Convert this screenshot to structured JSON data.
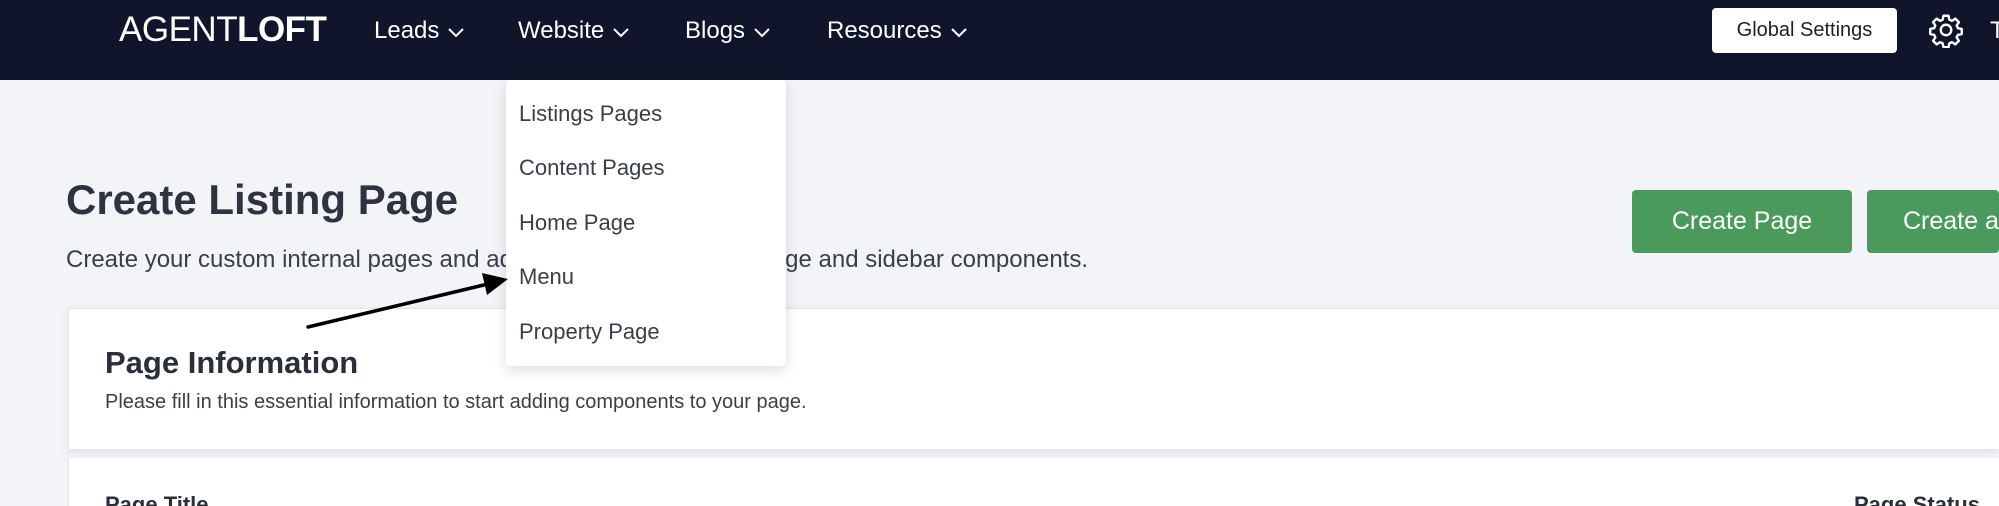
{
  "nav": {
    "logo_light": "AGENT",
    "logo_bold": "LOFT",
    "items": [
      {
        "label": "Leads"
      },
      {
        "label": "Website"
      },
      {
        "label": "Blogs"
      },
      {
        "label": "Resources"
      }
    ],
    "global_settings_label": "Global Settings",
    "cut_text": "T",
    "icons": {
      "chevron": "chevron-down-icon",
      "gear": "gear-icon"
    }
  },
  "header": {
    "title": "Create Listing Page",
    "subtitle": "Create your custom internal pages and add any of the supported page and sidebar components.",
    "create_page_label": "Create Page",
    "create_other_label": "Create a"
  },
  "dropdown": {
    "items": [
      {
        "label": "Listings Pages"
      },
      {
        "label": "Content Pages"
      },
      {
        "label": "Home Page"
      },
      {
        "label": "Menu"
      },
      {
        "label": "Property Page"
      }
    ]
  },
  "card": {
    "title": "Page Information",
    "description": "Please fill in this essential information to start adding components to your page."
  },
  "form": {
    "page_title_label": "Page Title",
    "page_status_label": "Page Status"
  },
  "colors": {
    "nav_bg": "#11152b",
    "page_bg": "#f3f4f8",
    "button_green": "#4a9a5b",
    "annotation_arrow": "#000000"
  }
}
